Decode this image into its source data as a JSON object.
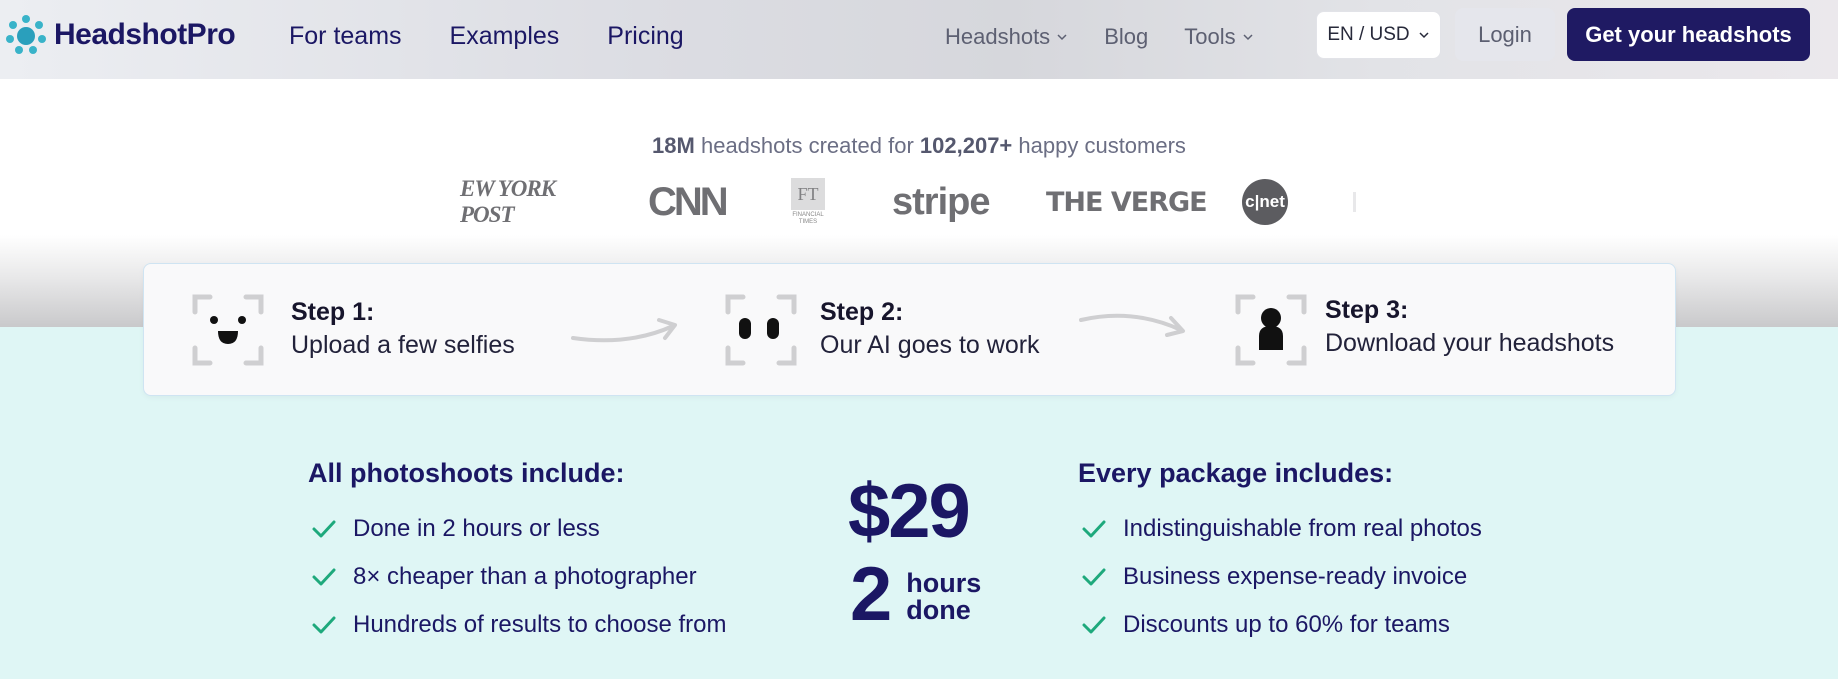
{
  "brand": {
    "name": "HeadshotPro",
    "color": "#1b1764",
    "accent": "#3ab8c8"
  },
  "nav": {
    "primary": [
      "For teams",
      "Examples",
      "Pricing"
    ],
    "secondary": [
      {
        "label": "Headshots",
        "has_dropdown": true
      },
      {
        "label": "Blog",
        "has_dropdown": false
      },
      {
        "label": "Tools",
        "has_dropdown": true
      }
    ],
    "locale": "EN / USD",
    "login": "Login",
    "cta": "Get your headshots"
  },
  "stats": {
    "headshots": "18M",
    "headshots_text": "headshots created for",
    "customers": "102,207+",
    "customers_text": "happy customers"
  },
  "press_logos": {
    "nypost": "EW YORK POST",
    "cnn": "CNN",
    "ft": "FT",
    "ft_sub": "FINANCIAL TIMES",
    "stripe": "stripe",
    "verge": "THE VERGE",
    "cnet": "c|net"
  },
  "steps": [
    {
      "title": "Step 1:",
      "desc": "Upload a few selfies",
      "icon": "smiley-face-icon"
    },
    {
      "title": "Step 2:",
      "desc": "Our AI goes to work",
      "icon": "ai-eyes-icon"
    },
    {
      "title": "Step 3:",
      "desc": "Download your headshots",
      "icon": "person-silhouette-icon"
    }
  ],
  "photoshoots": {
    "title": "All photoshoots include:",
    "items": [
      "Done in 2 hours or less",
      "8× cheaper than a photographer",
      "Hundreds of results to choose from"
    ]
  },
  "offer": {
    "price": "$29",
    "hours_num": "2",
    "hours_line1": "hours",
    "hours_line2": "done"
  },
  "packages": {
    "title": "Every package includes:",
    "items": [
      "Indistinguishable from real photos",
      "Business expense-ready invoice",
      "Discounts up to 60% for teams"
    ]
  },
  "colors": {
    "header_bg": "#dcdde3",
    "cta_bg": "#1f1a63",
    "teal_bg": "#dff6f5",
    "check": "#1ea97c"
  }
}
